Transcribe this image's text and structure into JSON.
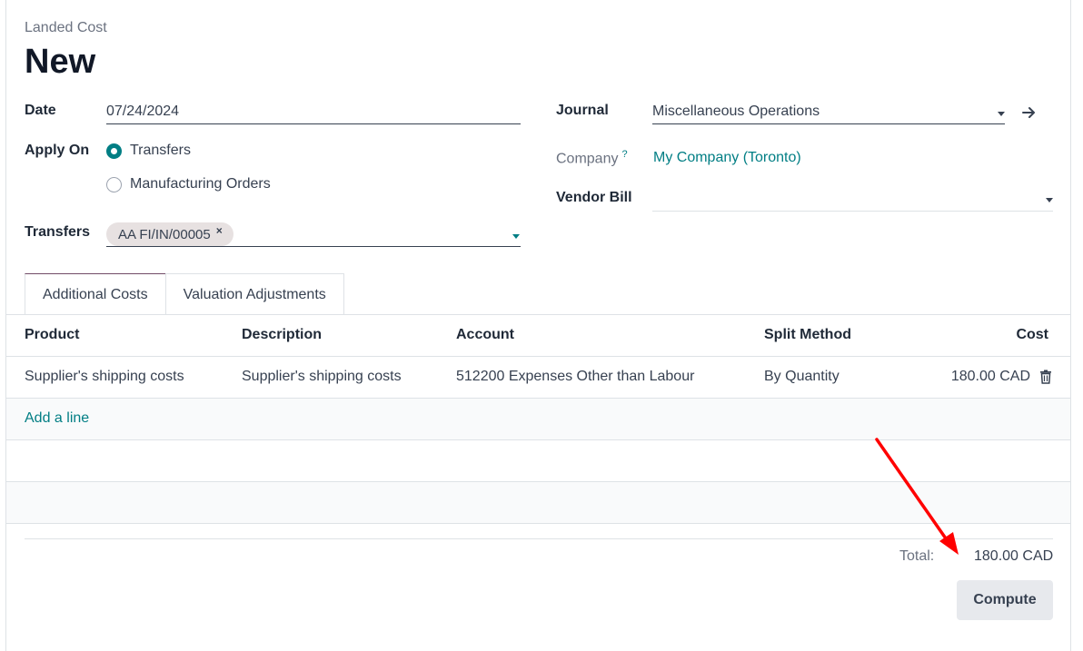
{
  "header": {
    "breadcrumb": "Landed Cost",
    "title": "New"
  },
  "form": {
    "date_label": "Date",
    "date_value": "07/24/2024",
    "apply_on_label": "Apply On",
    "apply_on_options": [
      "Transfers",
      "Manufacturing Orders"
    ],
    "apply_on_selected": "Transfers",
    "transfers_label": "Transfers",
    "transfers_tag": "AA FI/IN/00005",
    "transfers_tag_remove": "×",
    "journal_label": "Journal",
    "journal_value": "Miscellaneous Operations",
    "company_label": "Company",
    "company_help": "?",
    "company_value": "My Company (Toronto)",
    "vendor_bill_label": "Vendor Bill",
    "vendor_bill_value": ""
  },
  "tabs": [
    {
      "label": "Additional Costs",
      "active": true
    },
    {
      "label": "Valuation Adjustments",
      "active": false
    }
  ],
  "table": {
    "columns": [
      "Product",
      "Description",
      "Account",
      "Split Method",
      "Cost"
    ],
    "rows": [
      {
        "product": "Supplier's shipping costs",
        "description": "Supplier's shipping costs",
        "account": "512200 Expenses Other than Labour",
        "split_method": "By Quantity",
        "cost": "180.00 CAD"
      }
    ],
    "add_line": "Add a line"
  },
  "footer": {
    "total_label": "Total:",
    "total_value": "180.00 CAD",
    "compute_label": "Compute"
  },
  "colors": {
    "accent": "#017e84",
    "active_tab_border": "#714b67",
    "annotation_arrow": "#ff0000"
  },
  "icons": {
    "journal_open": "arrow-right-icon",
    "row_delete": "trash-icon"
  }
}
